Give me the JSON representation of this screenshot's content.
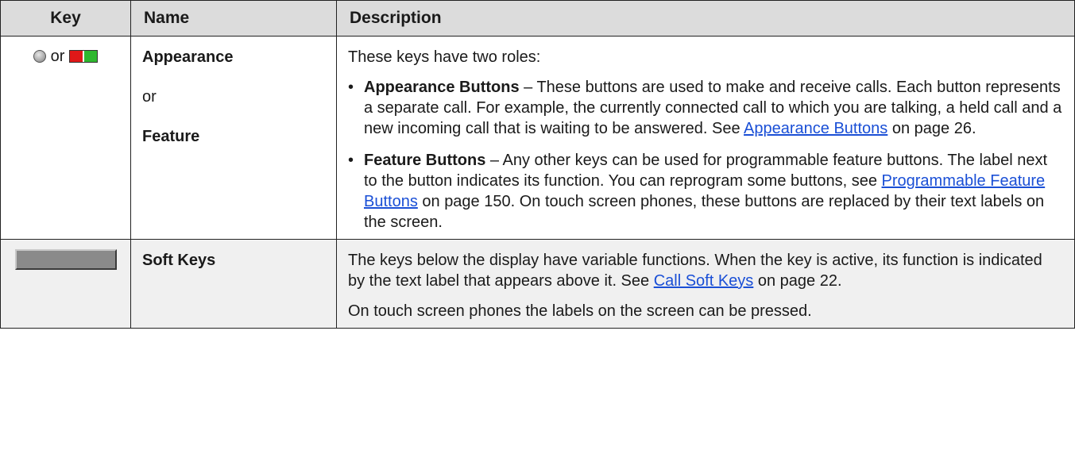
{
  "headers": {
    "key": "Key",
    "name": "Name",
    "description": "Description"
  },
  "row1": {
    "key_or": "or",
    "icons": [
      "grey-circle-icon",
      "red-green-led-icon"
    ],
    "name_1": "Appearance",
    "name_or": "or",
    "name_2": "Feature",
    "intro": "These keys have two roles:",
    "bullet1": {
      "title": "Appearance Buttons",
      "text_1": " – These buttons are used to make and receive calls. Each button represents a separate call. For example, the currently connected call to which you are talking, a held call and a new incoming call that is waiting to be answered. See ",
      "link": "Appearance Buttons",
      "text_2": " on page 26."
    },
    "bullet2": {
      "title": "Feature Buttons",
      "text_1": " – Any other keys can be used for programmable feature buttons. The label next to the button indicates its function. You can reprogram some buttons, see ",
      "link": "Programmable Feature Buttons",
      "text_2": " on page 150. On touch screen phones, these buttons are replaced by their text labels on the screen."
    }
  },
  "row2": {
    "icon": "grey-soft-key-icon",
    "name": "Soft Keys",
    "para1": {
      "text_1": "The keys below the display have variable functions. When the key is active, its function is indicated by the text label that appears above it. See ",
      "link": "Call Soft Keys",
      "text_2": " on page 22."
    },
    "para2": "On touch screen phones the labels on the screen can be pressed."
  },
  "colors": {
    "header_bg": "#dcdcdc",
    "alt_row_bg": "#f0f0f0",
    "link": "#1a4fd6",
    "led_red": "#e01818",
    "led_green": "#2eb72e"
  }
}
